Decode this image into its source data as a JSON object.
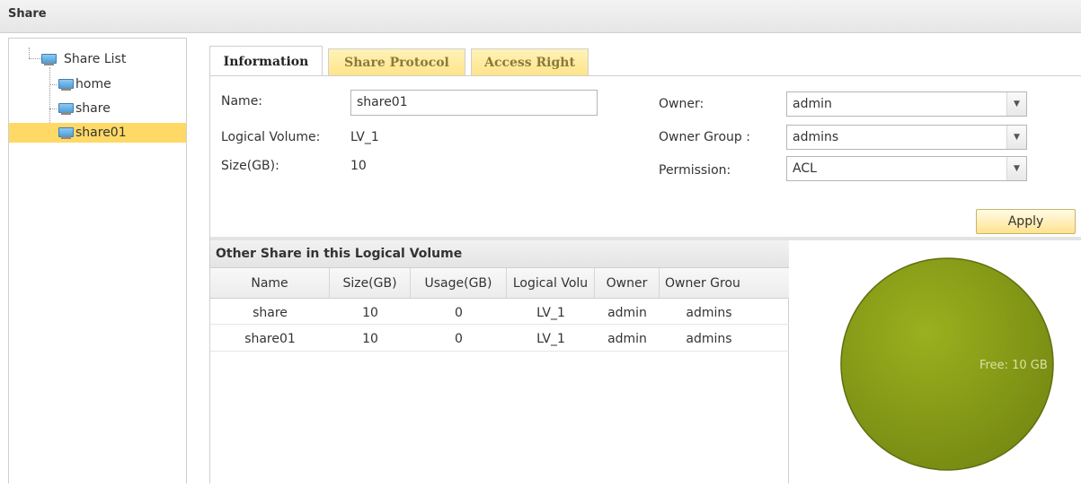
{
  "window": {
    "title": "Share"
  },
  "tree": {
    "root_label": "Share List",
    "items": [
      {
        "label": "home",
        "selected": false
      },
      {
        "label": "share",
        "selected": false
      },
      {
        "label": "share01",
        "selected": true
      }
    ]
  },
  "tabs": [
    {
      "label": "Information",
      "active": true
    },
    {
      "label": "Share Protocol",
      "active": false
    },
    {
      "label": "Access Right",
      "active": false
    }
  ],
  "form": {
    "name_label": "Name:",
    "name_value": "share01",
    "logical_volume_label": "Logical Volume:",
    "logical_volume_value": "LV_1",
    "size_label": "Size(GB):",
    "size_value": "10",
    "owner_label": "Owner:",
    "owner_value": "admin",
    "owner_group_label": "Owner Group :",
    "owner_group_value": "admins",
    "permission_label": "Permission:",
    "permission_value": "ACL",
    "apply_label": "Apply"
  },
  "grid": {
    "title": "Other Share in this Logical Volume",
    "columns": [
      "Name",
      "Size(GB)",
      "Usage(GB)",
      "Logical Volu",
      "Owner",
      "Owner Grou"
    ],
    "rows": [
      [
        "share",
        "10",
        "0",
        "LV_1",
        "admin",
        "admins"
      ],
      [
        "share01",
        "10",
        "0",
        "LV_1",
        "admin",
        "admins"
      ]
    ]
  },
  "chart_data": {
    "type": "pie",
    "slices": [
      {
        "label": "Free: 10 GB",
        "value": 10,
        "color": "#8a9e16"
      }
    ]
  },
  "colors": {
    "selected_bg": "#ffd966",
    "tab_inactive": "#ffe48a",
    "pie_fill": "#8a9e16"
  }
}
